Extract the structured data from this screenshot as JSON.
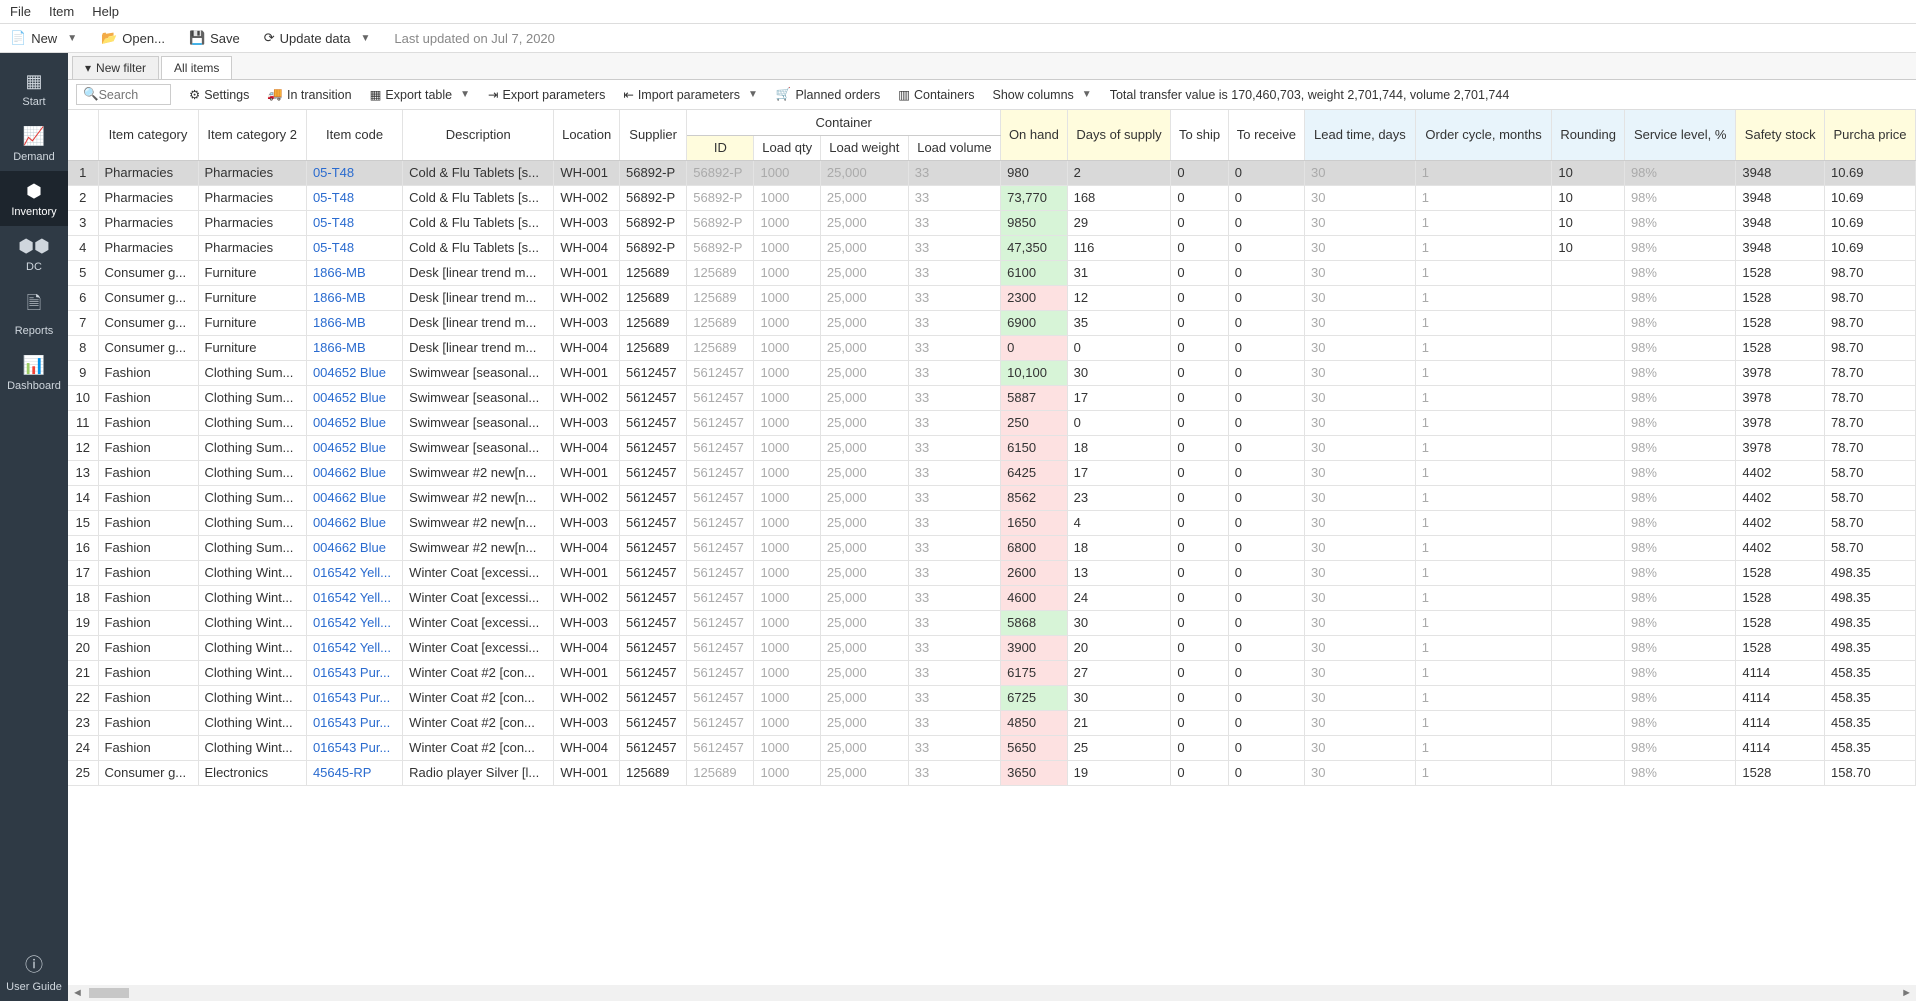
{
  "menu": {
    "file": "File",
    "item": "Item",
    "help": "Help"
  },
  "toolbar": {
    "new": "New",
    "open": "Open...",
    "save": "Save",
    "update": "Update data",
    "last_update": "Last updated on Jul 7, 2020"
  },
  "sidebar": {
    "start": "Start",
    "demand": "Demand",
    "inventory": "Inventory",
    "dc": "DC",
    "reports": "Reports",
    "dashboard": "Dashboard",
    "userguide": "User Guide"
  },
  "tabs": {
    "new_filter": "New filter",
    "all_items": "All items"
  },
  "toolbar2": {
    "search_ph": "Search",
    "settings": "Settings",
    "in_transition": "In transition",
    "export_table": "Export table",
    "export_params": "Export parameters",
    "import_params": "Import parameters",
    "planned_orders": "Planned orders",
    "containers": "Containers",
    "show_columns": "Show columns",
    "totals": "Total transfer value is 170,460,703, weight 2,701,744, volume 2,701,744"
  },
  "headers": {
    "item_cat": "Item category",
    "item_cat2": "Item category 2",
    "item_code": "Item code",
    "description": "Description",
    "location": "Location",
    "supplier": "Supplier",
    "container": "Container",
    "id": "ID",
    "load_qty": "Load qty",
    "load_weight": "Load weight",
    "load_volume": "Load volume",
    "on_hand": "On hand",
    "days_supply": "Days of supply",
    "to_ship": "To ship",
    "to_receive": "To receive",
    "lead_time": "Lead time, days",
    "order_cycle": "Order cycle, months",
    "rounding": "Rounding",
    "service_level": "Service level, %",
    "safety_stock": "Safety stock",
    "purchase_price": "Purcha price"
  },
  "rows": [
    {
      "n": 1,
      "cat": "Pharmacies",
      "cat2": "Pharmacies",
      "code": "05-T48",
      "desc": "Cold & Flu Tablets [s...",
      "loc": "WH-001",
      "sup": "56892-P",
      "cid": "56892-P",
      "lq": "1000",
      "lw": "25,000",
      "lv": "33",
      "oh": "980",
      "ohc": "r",
      "ds": "2",
      "ts": "0",
      "tr": "0",
      "lt": "30",
      "oc": "1",
      "rd": "10",
      "sl": "98%",
      "ss": "3948",
      "pp": "10.69",
      "sel": true
    },
    {
      "n": 2,
      "cat": "Pharmacies",
      "cat2": "Pharmacies",
      "code": "05-T48",
      "desc": "Cold & Flu Tablets [s...",
      "loc": "WH-002",
      "sup": "56892-P",
      "cid": "56892-P",
      "lq": "1000",
      "lw": "25,000",
      "lv": "33",
      "oh": "73,770",
      "ohc": "g",
      "ds": "168",
      "ts": "0",
      "tr": "0",
      "lt": "30",
      "oc": "1",
      "rd": "10",
      "sl": "98%",
      "ss": "3948",
      "pp": "10.69"
    },
    {
      "n": 3,
      "cat": "Pharmacies",
      "cat2": "Pharmacies",
      "code": "05-T48",
      "desc": "Cold & Flu Tablets [s...",
      "loc": "WH-003",
      "sup": "56892-P",
      "cid": "56892-P",
      "lq": "1000",
      "lw": "25,000",
      "lv": "33",
      "oh": "9850",
      "ohc": "g",
      "ds": "29",
      "ts": "0",
      "tr": "0",
      "lt": "30",
      "oc": "1",
      "rd": "10",
      "sl": "98%",
      "ss": "3948",
      "pp": "10.69"
    },
    {
      "n": 4,
      "cat": "Pharmacies",
      "cat2": "Pharmacies",
      "code": "05-T48",
      "desc": "Cold & Flu Tablets [s...",
      "loc": "WH-004",
      "sup": "56892-P",
      "cid": "56892-P",
      "lq": "1000",
      "lw": "25,000",
      "lv": "33",
      "oh": "47,350",
      "ohc": "g",
      "ds": "116",
      "ts": "0",
      "tr": "0",
      "lt": "30",
      "oc": "1",
      "rd": "10",
      "sl": "98%",
      "ss": "3948",
      "pp": "10.69"
    },
    {
      "n": 5,
      "cat": "Consumer g...",
      "cat2": "Furniture",
      "code": "1866-MB",
      "desc": "Desk [linear trend m...",
      "loc": "WH-001",
      "sup": "125689",
      "cid": "125689",
      "lq": "1000",
      "lw": "25,000",
      "lv": "33",
      "oh": "6100",
      "ohc": "g",
      "ds": "31",
      "ts": "0",
      "tr": "0",
      "lt": "30",
      "oc": "1",
      "rd": "",
      "sl": "98%",
      "ss": "1528",
      "pp": "98.70"
    },
    {
      "n": 6,
      "cat": "Consumer g...",
      "cat2": "Furniture",
      "code": "1866-MB",
      "desc": "Desk [linear trend m...",
      "loc": "WH-002",
      "sup": "125689",
      "cid": "125689",
      "lq": "1000",
      "lw": "25,000",
      "lv": "33",
      "oh": "2300",
      "ohc": "r",
      "ds": "12",
      "ts": "0",
      "tr": "0",
      "lt": "30",
      "oc": "1",
      "rd": "",
      "sl": "98%",
      "ss": "1528",
      "pp": "98.70"
    },
    {
      "n": 7,
      "cat": "Consumer g...",
      "cat2": "Furniture",
      "code": "1866-MB",
      "desc": "Desk [linear trend m...",
      "loc": "WH-003",
      "sup": "125689",
      "cid": "125689",
      "lq": "1000",
      "lw": "25,000",
      "lv": "33",
      "oh": "6900",
      "ohc": "g",
      "ds": "35",
      "ts": "0",
      "tr": "0",
      "lt": "30",
      "oc": "1",
      "rd": "",
      "sl": "98%",
      "ss": "1528",
      "pp": "98.70"
    },
    {
      "n": 8,
      "cat": "Consumer g...",
      "cat2": "Furniture",
      "code": "1866-MB",
      "desc": "Desk [linear trend m...",
      "loc": "WH-004",
      "sup": "125689",
      "cid": "125689",
      "lq": "1000",
      "lw": "25,000",
      "lv": "33",
      "oh": "0",
      "ohc": "r",
      "ds": "0",
      "ts": "0",
      "tr": "0",
      "lt": "30",
      "oc": "1",
      "rd": "",
      "sl": "98%",
      "ss": "1528",
      "pp": "98.70"
    },
    {
      "n": 9,
      "cat": "Fashion",
      "cat2": "Clothing Sum...",
      "code": "004652 Blue",
      "desc": "Swimwear [seasonal...",
      "loc": "WH-001",
      "sup": "5612457",
      "cid": "5612457",
      "lq": "1000",
      "lw": "25,000",
      "lv": "33",
      "oh": "10,100",
      "ohc": "g",
      "ds": "30",
      "ts": "0",
      "tr": "0",
      "lt": "30",
      "oc": "1",
      "rd": "",
      "sl": "98%",
      "ss": "3978",
      "pp": "78.70"
    },
    {
      "n": 10,
      "cat": "Fashion",
      "cat2": "Clothing Sum...",
      "code": "004652 Blue",
      "desc": "Swimwear [seasonal...",
      "loc": "WH-002",
      "sup": "5612457",
      "cid": "5612457",
      "lq": "1000",
      "lw": "25,000",
      "lv": "33",
      "oh": "5887",
      "ohc": "r",
      "ds": "17",
      "ts": "0",
      "tr": "0",
      "lt": "30",
      "oc": "1",
      "rd": "",
      "sl": "98%",
      "ss": "3978",
      "pp": "78.70"
    },
    {
      "n": 11,
      "cat": "Fashion",
      "cat2": "Clothing Sum...",
      "code": "004652 Blue",
      "desc": "Swimwear [seasonal...",
      "loc": "WH-003",
      "sup": "5612457",
      "cid": "5612457",
      "lq": "1000",
      "lw": "25,000",
      "lv": "33",
      "oh": "250",
      "ohc": "r",
      "ds": "0",
      "ts": "0",
      "tr": "0",
      "lt": "30",
      "oc": "1",
      "rd": "",
      "sl": "98%",
      "ss": "3978",
      "pp": "78.70"
    },
    {
      "n": 12,
      "cat": "Fashion",
      "cat2": "Clothing Sum...",
      "code": "004652 Blue",
      "desc": "Swimwear [seasonal...",
      "loc": "WH-004",
      "sup": "5612457",
      "cid": "5612457",
      "lq": "1000",
      "lw": "25,000",
      "lv": "33",
      "oh": "6150",
      "ohc": "r",
      "ds": "18",
      "ts": "0",
      "tr": "0",
      "lt": "30",
      "oc": "1",
      "rd": "",
      "sl": "98%",
      "ss": "3978",
      "pp": "78.70"
    },
    {
      "n": 13,
      "cat": "Fashion",
      "cat2": "Clothing Sum...",
      "code": "004662 Blue",
      "desc": "Swimwear #2 new[n...",
      "loc": "WH-001",
      "sup": "5612457",
      "cid": "5612457",
      "lq": "1000",
      "lw": "25,000",
      "lv": "33",
      "oh": "6425",
      "ohc": "r",
      "ds": "17",
      "ts": "0",
      "tr": "0",
      "lt": "30",
      "oc": "1",
      "rd": "",
      "sl": "98%",
      "ss": "4402",
      "pp": "58.70"
    },
    {
      "n": 14,
      "cat": "Fashion",
      "cat2": "Clothing Sum...",
      "code": "004662 Blue",
      "desc": "Swimwear #2 new[n...",
      "loc": "WH-002",
      "sup": "5612457",
      "cid": "5612457",
      "lq": "1000",
      "lw": "25,000",
      "lv": "33",
      "oh": "8562",
      "ohc": "r",
      "ds": "23",
      "ts": "0",
      "tr": "0",
      "lt": "30",
      "oc": "1",
      "rd": "",
      "sl": "98%",
      "ss": "4402",
      "pp": "58.70"
    },
    {
      "n": 15,
      "cat": "Fashion",
      "cat2": "Clothing Sum...",
      "code": "004662 Blue",
      "desc": "Swimwear #2 new[n...",
      "loc": "WH-003",
      "sup": "5612457",
      "cid": "5612457",
      "lq": "1000",
      "lw": "25,000",
      "lv": "33",
      "oh": "1650",
      "ohc": "r",
      "ds": "4",
      "ts": "0",
      "tr": "0",
      "lt": "30",
      "oc": "1",
      "rd": "",
      "sl": "98%",
      "ss": "4402",
      "pp": "58.70"
    },
    {
      "n": 16,
      "cat": "Fashion",
      "cat2": "Clothing Sum...",
      "code": "004662 Blue",
      "desc": "Swimwear #2 new[n...",
      "loc": "WH-004",
      "sup": "5612457",
      "cid": "5612457",
      "lq": "1000",
      "lw": "25,000",
      "lv": "33",
      "oh": "6800",
      "ohc": "r",
      "ds": "18",
      "ts": "0",
      "tr": "0",
      "lt": "30",
      "oc": "1",
      "rd": "",
      "sl": "98%",
      "ss": "4402",
      "pp": "58.70"
    },
    {
      "n": 17,
      "cat": "Fashion",
      "cat2": "Clothing Wint...",
      "code": "016542 Yell...",
      "desc": "Winter Coat [excessi...",
      "loc": "WH-001",
      "sup": "5612457",
      "cid": "5612457",
      "lq": "1000",
      "lw": "25,000",
      "lv": "33",
      "oh": "2600",
      "ohc": "r",
      "ds": "13",
      "ts": "0",
      "tr": "0",
      "lt": "30",
      "oc": "1",
      "rd": "",
      "sl": "98%",
      "ss": "1528",
      "pp": "498.35"
    },
    {
      "n": 18,
      "cat": "Fashion",
      "cat2": "Clothing Wint...",
      "code": "016542 Yell...",
      "desc": "Winter Coat [excessi...",
      "loc": "WH-002",
      "sup": "5612457",
      "cid": "5612457",
      "lq": "1000",
      "lw": "25,000",
      "lv": "33",
      "oh": "4600",
      "ohc": "r",
      "ds": "24",
      "ts": "0",
      "tr": "0",
      "lt": "30",
      "oc": "1",
      "rd": "",
      "sl": "98%",
      "ss": "1528",
      "pp": "498.35"
    },
    {
      "n": 19,
      "cat": "Fashion",
      "cat2": "Clothing Wint...",
      "code": "016542 Yell...",
      "desc": "Winter Coat [excessi...",
      "loc": "WH-003",
      "sup": "5612457",
      "cid": "5612457",
      "lq": "1000",
      "lw": "25,000",
      "lv": "33",
      "oh": "5868",
      "ohc": "g",
      "ds": "30",
      "ts": "0",
      "tr": "0",
      "lt": "30",
      "oc": "1",
      "rd": "",
      "sl": "98%",
      "ss": "1528",
      "pp": "498.35"
    },
    {
      "n": 20,
      "cat": "Fashion",
      "cat2": "Clothing Wint...",
      "code": "016542 Yell...",
      "desc": "Winter Coat [excessi...",
      "loc": "WH-004",
      "sup": "5612457",
      "cid": "5612457",
      "lq": "1000",
      "lw": "25,000",
      "lv": "33",
      "oh": "3900",
      "ohc": "r",
      "ds": "20",
      "ts": "0",
      "tr": "0",
      "lt": "30",
      "oc": "1",
      "rd": "",
      "sl": "98%",
      "ss": "1528",
      "pp": "498.35"
    },
    {
      "n": 21,
      "cat": "Fashion",
      "cat2": "Clothing Wint...",
      "code": "016543 Pur...",
      "desc": "Winter Coat #2 [con...",
      "loc": "WH-001",
      "sup": "5612457",
      "cid": "5612457",
      "lq": "1000",
      "lw": "25,000",
      "lv": "33",
      "oh": "6175",
      "ohc": "r",
      "ds": "27",
      "ts": "0",
      "tr": "0",
      "lt": "30",
      "oc": "1",
      "rd": "",
      "sl": "98%",
      "ss": "4114",
      "pp": "458.35"
    },
    {
      "n": 22,
      "cat": "Fashion",
      "cat2": "Clothing Wint...",
      "code": "016543 Pur...",
      "desc": "Winter Coat #2 [con...",
      "loc": "WH-002",
      "sup": "5612457",
      "cid": "5612457",
      "lq": "1000",
      "lw": "25,000",
      "lv": "33",
      "oh": "6725",
      "ohc": "g",
      "ds": "30",
      "ts": "0",
      "tr": "0",
      "lt": "30",
      "oc": "1",
      "rd": "",
      "sl": "98%",
      "ss": "4114",
      "pp": "458.35"
    },
    {
      "n": 23,
      "cat": "Fashion",
      "cat2": "Clothing Wint...",
      "code": "016543 Pur...",
      "desc": "Winter Coat #2 [con...",
      "loc": "WH-003",
      "sup": "5612457",
      "cid": "5612457",
      "lq": "1000",
      "lw": "25,000",
      "lv": "33",
      "oh": "4850",
      "ohc": "r",
      "ds": "21",
      "ts": "0",
      "tr": "0",
      "lt": "30",
      "oc": "1",
      "rd": "",
      "sl": "98%",
      "ss": "4114",
      "pp": "458.35"
    },
    {
      "n": 24,
      "cat": "Fashion",
      "cat2": "Clothing Wint...",
      "code": "016543 Pur...",
      "desc": "Winter Coat #2 [con...",
      "loc": "WH-004",
      "sup": "5612457",
      "cid": "5612457",
      "lq": "1000",
      "lw": "25,000",
      "lv": "33",
      "oh": "5650",
      "ohc": "r",
      "ds": "25",
      "ts": "0",
      "tr": "0",
      "lt": "30",
      "oc": "1",
      "rd": "",
      "sl": "98%",
      "ss": "4114",
      "pp": "458.35"
    },
    {
      "n": 25,
      "cat": "Consumer g...",
      "cat2": "Electronics",
      "code": "45645-RP",
      "desc": "Radio player Silver [l...",
      "loc": "WH-001",
      "sup": "125689",
      "cid": "125689",
      "lq": "1000",
      "lw": "25,000",
      "lv": "33",
      "oh": "3650",
      "ohc": "r",
      "ds": "19",
      "ts": "0",
      "tr": "0",
      "lt": "30",
      "oc": "1",
      "rd": "",
      "sl": "98%",
      "ss": "1528",
      "pp": "158.70"
    }
  ]
}
